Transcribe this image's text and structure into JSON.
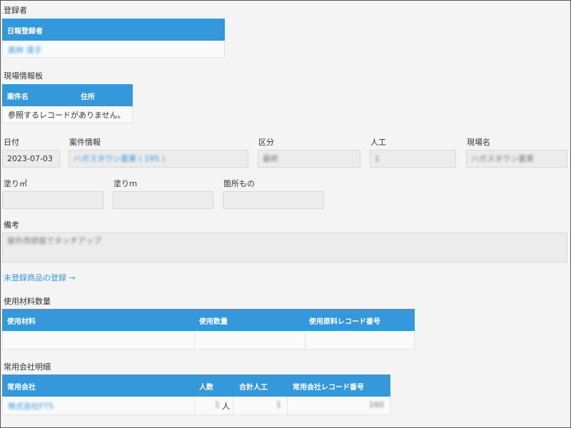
{
  "registrant": {
    "section_label": "登録者",
    "header": "日報登録者",
    "value": "高林 清子"
  },
  "site_board": {
    "section_label": "現場情報板",
    "columns": [
      "案件名",
      "住所"
    ],
    "empty_message": "参照するレコードがありません。"
  },
  "fields_row1": {
    "date": {
      "label": "日付",
      "value": "2023-07-03"
    },
    "project": {
      "label": "案件情報",
      "value": "ハガスタウン書東",
      "paren": "( 195 )"
    },
    "category": {
      "label": "区分",
      "value": "最終"
    },
    "labor": {
      "label": "人工",
      "value": "1"
    },
    "site_name": {
      "label": "現場名",
      "value": "ハガスタウン書東"
    }
  },
  "fields_row2": {
    "paint_sqm": {
      "label": "塗り㎡",
      "value": ""
    },
    "paint_m": {
      "label": "塗りｍ",
      "value": ""
    },
    "spots": {
      "label": "箇所もの",
      "value": ""
    }
  },
  "remarks": {
    "label": "備考",
    "value": "屋外改修面でタッチアップ"
  },
  "unregistered_link": "未登録商品の登録 →",
  "materials": {
    "section_label": "使用材料数量",
    "columns": [
      "使用材料",
      "使用数量",
      "使用原料レコード番号"
    ]
  },
  "staff": {
    "section_label": "常用会社明細",
    "columns": [
      "常用会社",
      "人数",
      "合計人工",
      "常用会社レコード番号"
    ],
    "row": {
      "company": "株式会社FTS",
      "count": "1",
      "count_unit": "人",
      "total_labor": "1",
      "record_no": "160"
    }
  }
}
